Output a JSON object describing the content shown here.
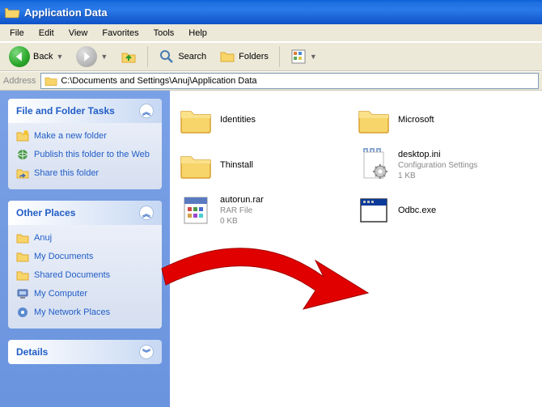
{
  "window": {
    "title": "Application Data"
  },
  "menu": {
    "file": "File",
    "edit": "Edit",
    "view": "View",
    "favorites": "Favorites",
    "tools": "Tools",
    "help": "Help"
  },
  "toolbar": {
    "back": "Back",
    "search": "Search",
    "folders": "Folders"
  },
  "address": {
    "label": "Address",
    "value": "C:\\Documents and Settings\\Anuj\\Application Data"
  },
  "sidebar": {
    "tasks": {
      "title": "File and Folder Tasks",
      "items": [
        {
          "label": "Make a new folder"
        },
        {
          "label": "Publish this folder to the Web"
        },
        {
          "label": "Share this folder"
        }
      ]
    },
    "places": {
      "title": "Other Places",
      "items": [
        {
          "label": "Anuj"
        },
        {
          "label": "My Documents"
        },
        {
          "label": "Shared Documents"
        },
        {
          "label": "My Computer"
        },
        {
          "label": "My Network Places"
        }
      ]
    },
    "details": {
      "title": "Details"
    }
  },
  "files": [
    {
      "name": "Identities",
      "type": "folder"
    },
    {
      "name": "Microsoft",
      "type": "folder"
    },
    {
      "name": "Thinstall",
      "type": "folder"
    },
    {
      "name": "desktop.ini",
      "type": "config",
      "meta1": "Configuration Settings",
      "meta2": "1 KB"
    },
    {
      "name": "autorun.rar",
      "type": "rar",
      "meta1": "RAR File",
      "meta2": "0 KB"
    },
    {
      "name": "Odbc.exe",
      "type": "exe"
    }
  ]
}
